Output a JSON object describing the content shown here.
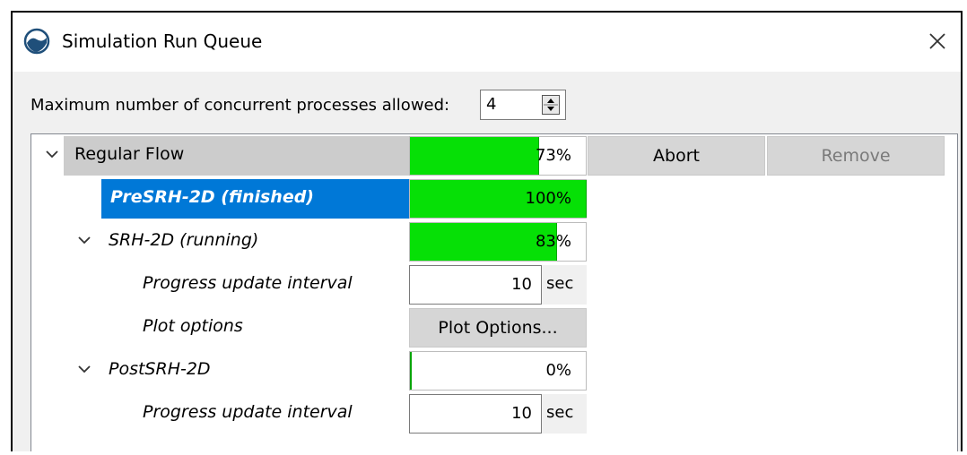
{
  "window": {
    "title": "Simulation Run Queue"
  },
  "settings": {
    "max_processes_label": "Maximum number of concurrent processes allowed:",
    "max_processes_value": "4"
  },
  "tree": {
    "group": {
      "label": "Regular Flow",
      "progress": 73,
      "progress_text": "73%",
      "abort_label": "Abort",
      "remove_label": "Remove"
    },
    "presrh": {
      "label": "PreSRH-2D (finished)",
      "progress": 100,
      "progress_text": "100%"
    },
    "srh": {
      "label": "SRH-2D (running)",
      "progress": 83,
      "progress_text": "83%",
      "interval_label": "Progress update interval",
      "interval_value": "10",
      "interval_unit": "sec",
      "plot_label": "Plot options",
      "plot_button": "Plot Options..."
    },
    "postsrh": {
      "label": "PostSRH-2D",
      "progress": 0,
      "progress_text": "0%",
      "interval_label": "Progress update interval",
      "interval_value": "10",
      "interval_unit": "sec"
    }
  },
  "colors": {
    "progress_fill": "#06e006",
    "selection": "#0078d7",
    "group_bg": "#cccccc",
    "button_bg": "#d6d6d6"
  },
  "icons": {
    "app": "globe-wave-icon",
    "close": "close-icon",
    "chevron": "chevron-down-icon",
    "spin": "spinner-arrows-icon"
  }
}
